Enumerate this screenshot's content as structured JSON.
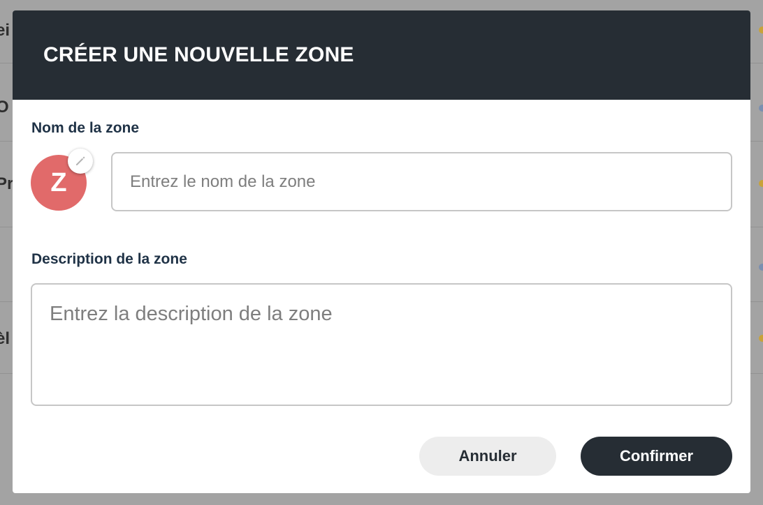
{
  "background": {
    "rows": [
      {
        "label": "ei",
        "dot_color": "#c8a23a"
      },
      {
        "label": "O",
        "dot_color": "#7b8fb0"
      },
      {
        "label": "Pr",
        "dot_color": "#c8a23a"
      },
      {
        "label": "",
        "dot_color": "#7b8fb0"
      },
      {
        "label": "èl",
        "dot_color": "#c8a23a"
      }
    ]
  },
  "modal": {
    "title": "CRÉER UNE NOUVELLE ZONE",
    "name_label": "Nom de la zone",
    "avatar_letter": "Z",
    "avatar_color": "#e16a6a",
    "edit_icon": "pencil-icon",
    "name_placeholder": "Entrez le nom de la zone",
    "name_value": "",
    "description_label": "Description de la zone",
    "description_placeholder": "Entrez la description de la zone",
    "description_value": "",
    "cancel_label": "Annuler",
    "confirm_label": "Confirmer"
  },
  "colors": {
    "header_bg": "#262d34",
    "label_color": "#1f3246"
  }
}
